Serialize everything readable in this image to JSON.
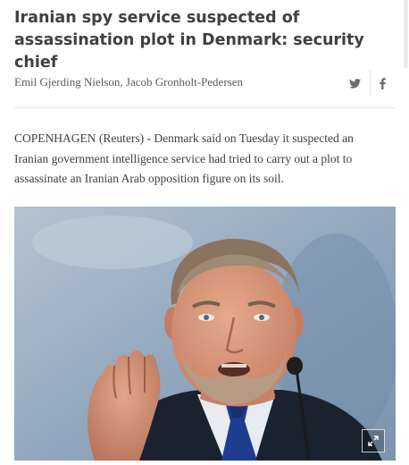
{
  "article": {
    "headline": "Iranian spy service suspected of assassination plot in Denmark: security chief",
    "byline": "Emil Gjerding Nielson, Jacob Gronholt-Pedersen",
    "body": "COPENHAGEN (Reuters) - Denmark said on Tuesday it suspected an Iranian government intelligence service had tried to carry out a plot to assassinate an Iranian Arab opposition figure on its soil."
  },
  "share": {
    "icons": [
      "twitter-icon",
      "facebook-icon"
    ]
  },
  "photo": {
    "alt_subject": "man speaking at a microphone",
    "expand_icon": "expand-icon"
  },
  "colors": {
    "text": "#404040",
    "byline": "#5a5a5a",
    "divider": "#e6e6e6",
    "icon": "#6b6b6b"
  }
}
